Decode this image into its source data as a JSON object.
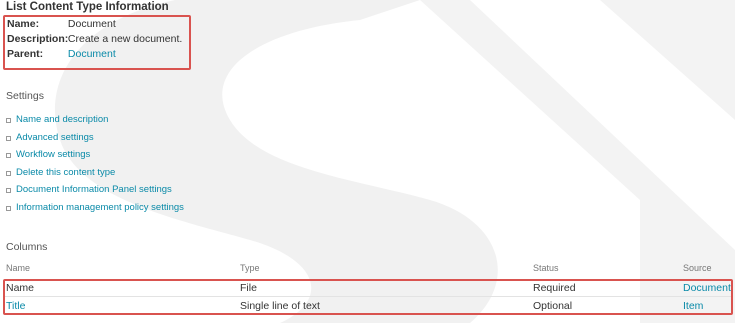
{
  "info": {
    "section_title": "List Content Type Information",
    "name_label": "Name:",
    "name_value": "Document",
    "description_label": "Description:",
    "description_value": "Create a new document.",
    "parent_label": "Parent:",
    "parent_value": "Document"
  },
  "settings": {
    "title": "Settings",
    "items": [
      "Name and description",
      "Advanced settings",
      "Workflow settings",
      "Delete this content type",
      "Document Information Panel settings",
      "Information management policy settings"
    ]
  },
  "columns": {
    "title": "Columns",
    "headers": [
      "Name",
      "Type",
      "Status",
      "Source"
    ],
    "rows": [
      {
        "name": "Name",
        "type": "File",
        "status": "Required",
        "source": "Document"
      },
      {
        "name": "Title",
        "type": "Single line of text",
        "status": "Optional",
        "source": "Item"
      }
    ]
  },
  "colors": {
    "link": "#0a8aa8",
    "highlight_border": "#d9534f"
  }
}
